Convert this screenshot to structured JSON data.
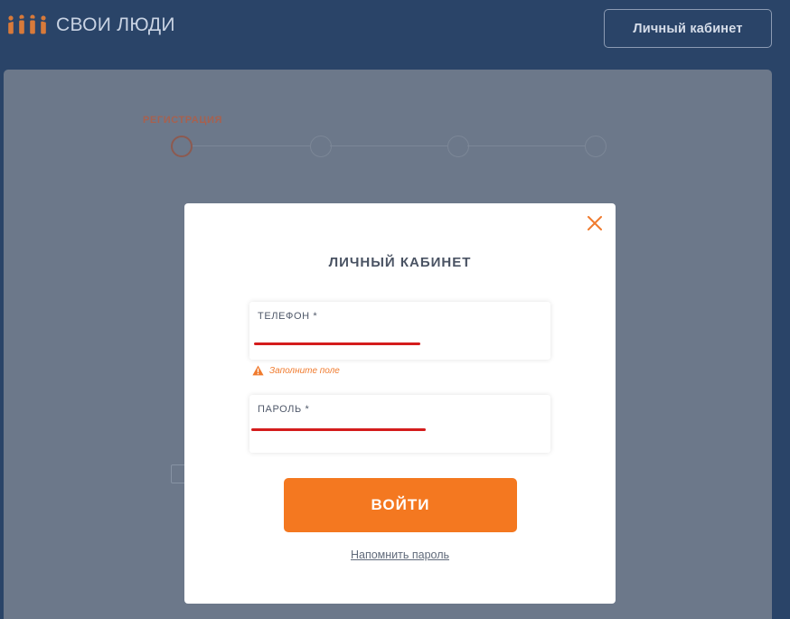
{
  "header": {
    "logo_text": "СВОИ ЛЮДИ",
    "cabinet_button": "Личный кабинет"
  },
  "background_page": {
    "steps_title": "РЕГИСТРАЦИЯ"
  },
  "modal": {
    "title": "ЛИЧНЫЙ КАБИНЕТ",
    "phone_label": "ТЕЛЕФОН *",
    "phone_error": "Заполните поле",
    "password_label": "ПАРОЛЬ *",
    "submit_label": "ВОЙТИ",
    "remind_link": "Напомнить пароль"
  },
  "colors": {
    "accent": "#f47820",
    "header_bg": "#2a4468",
    "overlay_card": "#6c788a",
    "error": "#f07b2e",
    "redaction": "#d41c1c"
  },
  "icons": {
    "logo": "people-group-icon",
    "close": "close-icon",
    "warning": "warning-icon"
  }
}
